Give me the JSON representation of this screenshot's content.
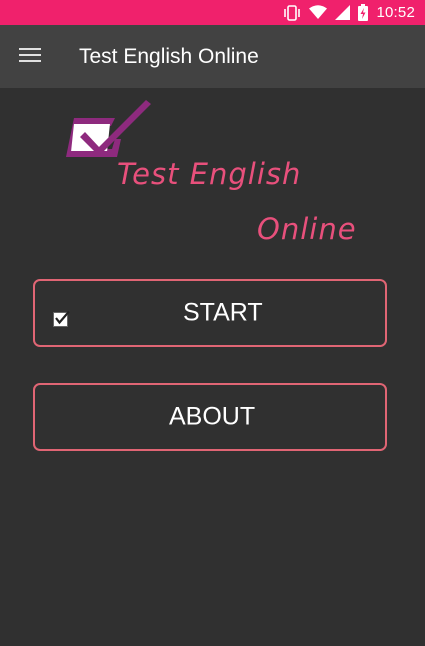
{
  "status_bar": {
    "time": "10:52",
    "color": "#f0216c",
    "icons": [
      "vibrate-icon",
      "wifi-icon",
      "signal-icon",
      "battery-charging-icon"
    ]
  },
  "app_bar": {
    "title": "Test English Online",
    "menu_icon": "hamburger-menu-icon",
    "color": "#424242"
  },
  "logo": {
    "line1": "Test English",
    "line2": "Online",
    "text_color": "#e8507c",
    "check_color": "#8e2a7e"
  },
  "buttons": {
    "start_label": "START",
    "about_label": "ABOUT",
    "border_color": "#e06574"
  },
  "theme": {
    "background": "#303030"
  }
}
